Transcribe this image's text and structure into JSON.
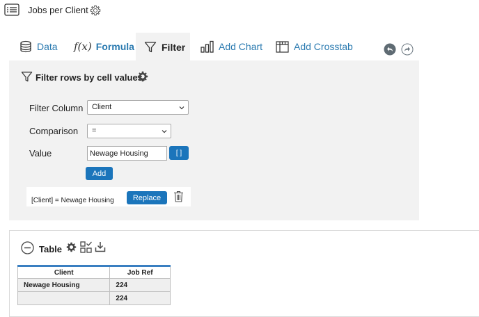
{
  "header": {
    "title": "Jobs per Client",
    "menu_icon": "list-icon",
    "settings_icon": "gear-icon"
  },
  "tabs": [
    {
      "label": "Data",
      "icon": "database-icon",
      "active": false
    },
    {
      "label": "Formula",
      "icon": "function-icon",
      "active": false
    },
    {
      "label": "Filter",
      "icon": "funnel-icon",
      "active": true
    },
    {
      "label": "Add Chart",
      "icon": "bar-chart-icon",
      "active": false
    },
    {
      "label": "Add Crosstab",
      "icon": "crosstab-icon",
      "active": false
    }
  ],
  "formula_icon_text": "f(x)",
  "history": {
    "undo_icon": "undo-icon",
    "redo_icon": "redo-icon"
  },
  "filter": {
    "heading": "Filter rows by cell values.",
    "column_label": "Filter Column",
    "column_value": "Client",
    "comparison_label": "Comparison",
    "comparison_value": "=",
    "value_label": "Value",
    "value_input": "Newage Housing",
    "bracket_button": "[ ]",
    "add_button": "Add",
    "rule_text": "[Client] = Newage Housing",
    "replace_button": "Replace"
  },
  "table": {
    "heading": "Table",
    "columns": [
      "Client",
      "Job Ref"
    ],
    "rows": [
      [
        "Newage Housing",
        "224"
      ],
      [
        "",
        "224"
      ]
    ]
  },
  "colors": {
    "accent_blue": "#1b75bb",
    "link_blue": "#2a7ab0",
    "panel_gray": "#f2f2f2",
    "table_header_border": "#3a7fc1"
  }
}
